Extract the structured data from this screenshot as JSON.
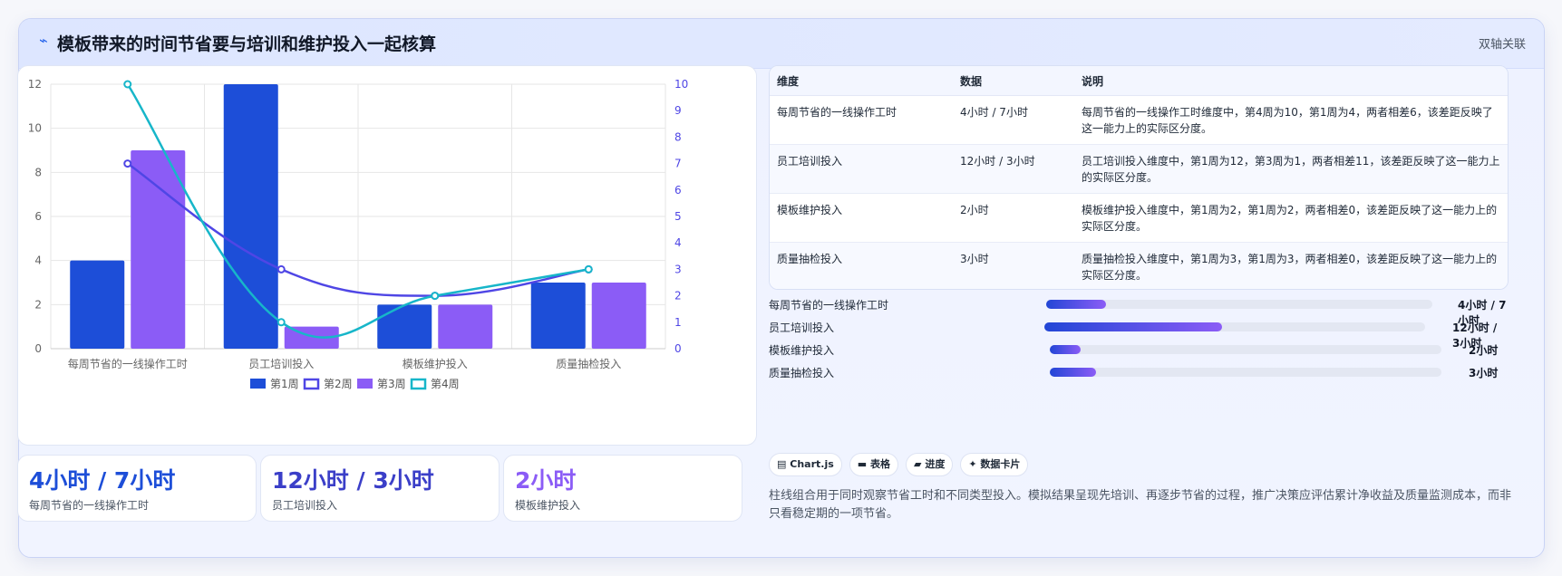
{
  "header": {
    "icon": "bolt-icon",
    "title": "模板带来的时间节省要与培训和维护投入一起核算",
    "tag": "双轴关联"
  },
  "chart_data": {
    "type": "bar",
    "categories": [
      "每周节省的一线操作工时",
      "员工培训投入",
      "模板维护投入",
      "质量抽检投入"
    ],
    "left_axis": {
      "ylim": [
        0,
        12
      ],
      "ticks": [
        "0",
        "2",
        "4",
        "6",
        "8",
        "10",
        "12"
      ]
    },
    "right_axis": {
      "ylim": [
        0,
        10
      ],
      "ticks": [
        "0",
        "1",
        "2",
        "3",
        "4",
        "5",
        "6",
        "7",
        "8",
        "9",
        "10"
      ]
    },
    "series": [
      {
        "name": "第1周",
        "kind": "bar",
        "axis": "left",
        "color": "#1d4ed8",
        "values": [
          4,
          12,
          2,
          3
        ]
      },
      {
        "name": "第2周",
        "kind": "line",
        "axis": "right",
        "color": "#4f46e5",
        "values": [
          7,
          3,
          2,
          3
        ]
      },
      {
        "name": "第3周",
        "kind": "bar",
        "axis": "left",
        "color": "#8b5cf6",
        "values": [
          9,
          1,
          2,
          3
        ]
      },
      {
        "name": "第4周",
        "kind": "line",
        "axis": "right",
        "color": "#17b6c9",
        "values": [
          10,
          1,
          2,
          3
        ]
      }
    ],
    "grid": true,
    "legend": "bottom"
  },
  "stats": [
    {
      "value": "4小时 / 7小时",
      "label": "每周节省的一线操作工时",
      "color": "#1d4ed8"
    },
    {
      "value": "12小时 / 3小时",
      "label": "员工培训投入",
      "color": "#3b3fc8"
    },
    {
      "value": "2小时",
      "label": "模板维护投入",
      "color": "#8b5cf6"
    }
  ],
  "table": {
    "headers": [
      "维度",
      "数据",
      "说明"
    ],
    "rows": [
      {
        "dim": "每周节省的一线操作工时",
        "data": "4小时 / 7小时",
        "desc": "每周节省的一线操作工时维度中，第4周为10，第1周为4，两者相差6，该差距反映了这一能力上的实际区分度。"
      },
      {
        "dim": "员工培训投入",
        "data": "12小时 / 3小时",
        "desc": "员工培训投入维度中，第1周为12，第3周为1，两者相差11，该差距反映了这一能力上的实际区分度。"
      },
      {
        "dim": "模板维护投入",
        "data": "2小时",
        "desc": "模板维护投入维度中，第1周为2，第1周为2，两者相差0，该差距反映了这一能力上的实际区分度。"
      },
      {
        "dim": "质量抽检投入",
        "data": "3小时",
        "desc": "质量抽检投入维度中，第1周为3，第1周为3，两者相差0，该差距反映了这一能力上的实际区分度。"
      }
    ]
  },
  "progress": [
    {
      "label": "每周节省的一线操作工时",
      "value": "4小时 / 7小时",
      "fraction": 0.155
    },
    {
      "label": "员工培训投入",
      "value": "12小时 / 3小时",
      "fraction": 0.466
    },
    {
      "label": "模板维护投入",
      "value": "2小时",
      "fraction": 0.078
    },
    {
      "label": "质量抽检投入",
      "value": "3小时",
      "fraction": 0.118
    }
  ],
  "pills": [
    {
      "icon": "chart-icon",
      "glyph": "▤",
      "label": "Chart.js"
    },
    {
      "icon": "table-icon",
      "glyph": "▬",
      "label": "表格"
    },
    {
      "icon": "progress-icon",
      "glyph": "▰",
      "label": "进度"
    },
    {
      "icon": "card-icon",
      "glyph": "✦",
      "label": "数据卡片"
    }
  ],
  "note": "柱线组合用于同时观察节省工时和不同类型投入。模拟结果呈现先培训、再逐步节省的过程，推广决策应评估累计净收益及质量监测成本，而非只看稳定期的一项节省。"
}
